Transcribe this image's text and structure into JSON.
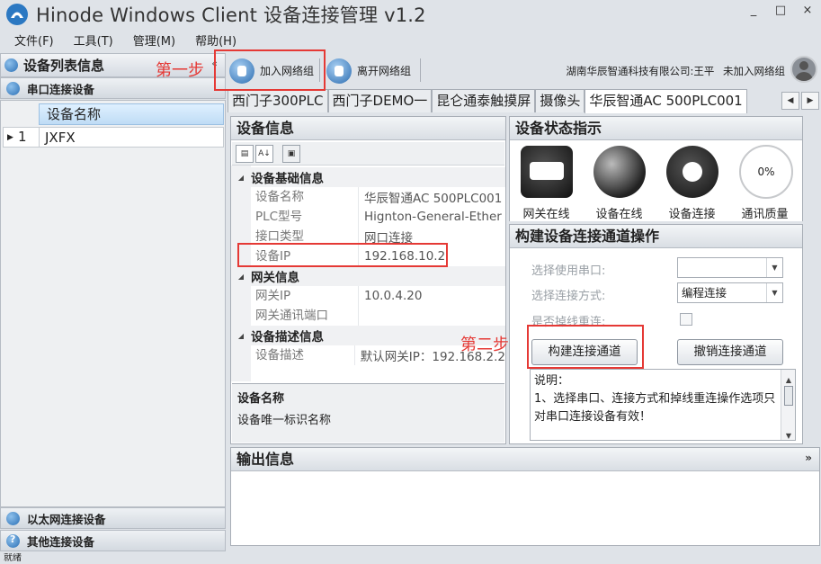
{
  "window": {
    "title": "Hinode Windows Client 设备连接管理 v1.2",
    "controls": [
      "_",
      "□",
      "×"
    ]
  },
  "menu": [
    "文件(F)",
    "工具(T)",
    "管理(M)",
    "帮助(H)"
  ],
  "left": {
    "header": "设备列表信息",
    "sections": {
      "serial": "串口连接设备",
      "ethernet": "以太网连接设备",
      "other": "其他连接设备"
    },
    "grid": {
      "column": "设备名称",
      "rows": [
        {
          "num": "1",
          "name": "JXFX"
        }
      ]
    }
  },
  "toolbar": {
    "join": "加入网络组",
    "leave": "离开网络组",
    "company": "湖南华辰智通科技有限公司:王平",
    "status": "未加入网络组"
  },
  "tabs": [
    "西门子300PLC",
    "西门子DEMO一",
    "昆仑通泰触摸屏",
    "摄像头",
    "华辰智通AC 500PLC001"
  ],
  "active_tab": 4,
  "device_info": {
    "title": "设备信息",
    "categories": {
      "basic": "设备基础信息",
      "gateway": "网关信息",
      "desc": "设备描述信息"
    },
    "props": {
      "name": {
        "key": "设备名称",
        "value": "华辰智通AC 500PLC001"
      },
      "plc": {
        "key": "PLC型号",
        "value": "Hignton-General-Ether"
      },
      "iface": {
        "key": "接口类型",
        "value": "网口连接"
      },
      "ip": {
        "key": "设备IP",
        "value": "192.168.10.2"
      },
      "gwip": {
        "key": "网关IP",
        "value": "10.0.4.20"
      },
      "gwport": {
        "key": "网关通讯端口",
        "value": ""
      },
      "descr": {
        "key": "设备描述",
        "value": "默认网关IP：192.168.2.2"
      }
    },
    "help_title": "设备名称",
    "help_text": "设备唯一标识名称"
  },
  "status_panel": {
    "title": "设备状态指示",
    "items": {
      "gateway": "网关在线",
      "device": "设备在线",
      "connect": "设备连接",
      "quality": "通讯质量"
    },
    "quality_value": "0%"
  },
  "build": {
    "title": "构建设备连接通道操作",
    "serial_label": "选择使用串口:",
    "serial_value": "",
    "mode_label": "选择连接方式:",
    "mode_value": "编程连接",
    "reconnect_label": "是否掉线重连:",
    "build_btn": "构建连接通道",
    "cancel_btn": "撤销连接通道",
    "note": "说明：\n1、选择串口、连接方式和掉线重连操作选项只对串口连接设备有效！"
  },
  "output": {
    "title": "输出信息"
  },
  "annotations": {
    "step1": "第一步",
    "step2": "第二步"
  },
  "statusbar": "就绪",
  "colors": {
    "annotation": "#e53935",
    "accent": "#2b6cb0"
  }
}
